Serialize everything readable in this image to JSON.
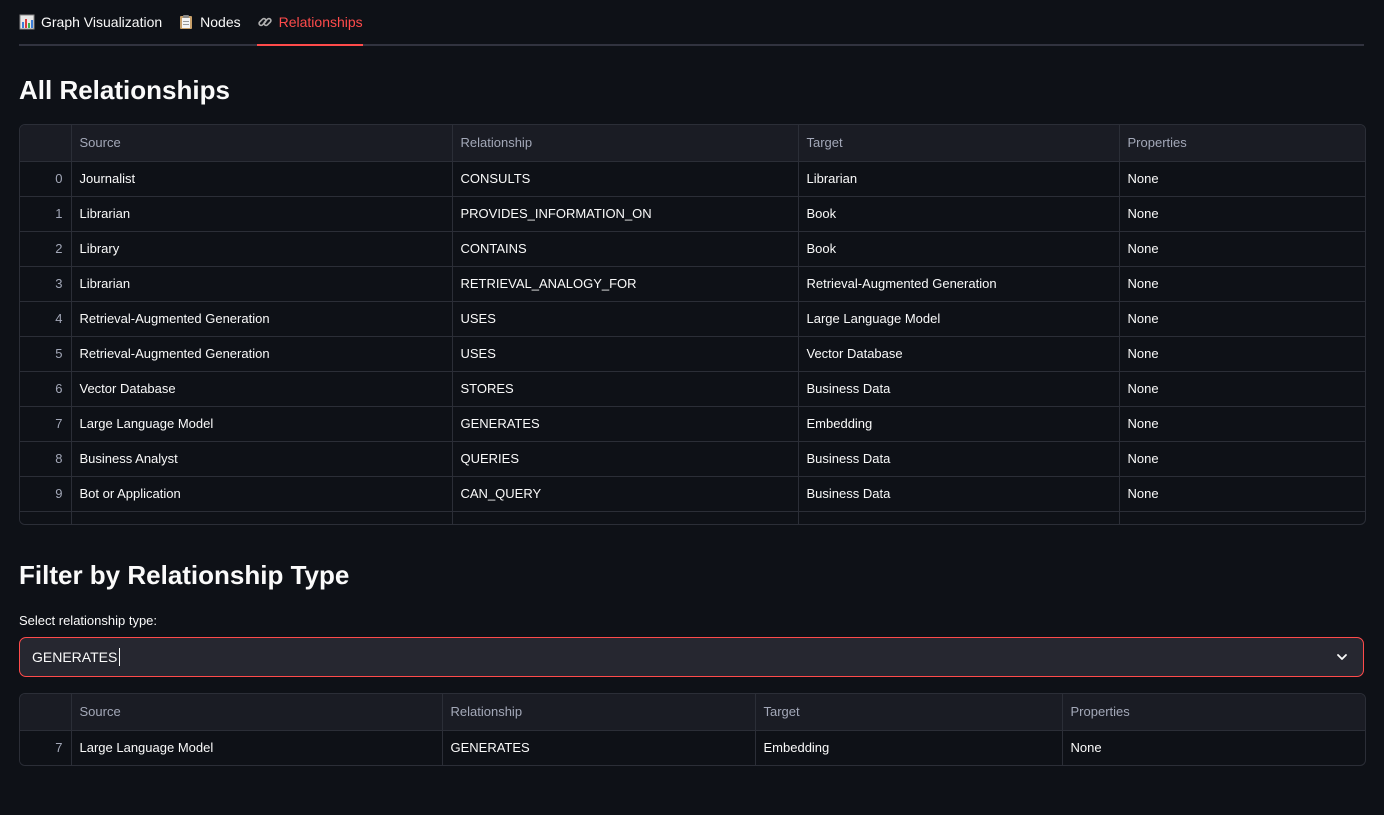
{
  "tabs": [
    {
      "label": "Graph Visualization",
      "icon": "bar-chart-icon",
      "active": false
    },
    {
      "label": "Nodes",
      "icon": "clipboard-icon",
      "active": false
    },
    {
      "label": "Relationships",
      "icon": "link-icon",
      "active": true
    }
  ],
  "all_section": {
    "title": "All Relationships",
    "columns": [
      "",
      "Source",
      "Relationship",
      "Target",
      "Properties"
    ],
    "rows": [
      {
        "idx": "0",
        "source": "Journalist",
        "relationship": "CONSULTS",
        "target": "Librarian",
        "properties": "None"
      },
      {
        "idx": "1",
        "source": "Librarian",
        "relationship": "PROVIDES_INFORMATION_ON",
        "target": "Book",
        "properties": "None"
      },
      {
        "idx": "2",
        "source": "Library",
        "relationship": "CONTAINS",
        "target": "Book",
        "properties": "None"
      },
      {
        "idx": "3",
        "source": "Librarian",
        "relationship": "RETRIEVAL_ANALOGY_FOR",
        "target": "Retrieval-Augmented Generation",
        "properties": "None"
      },
      {
        "idx": "4",
        "source": "Retrieval-Augmented Generation",
        "relationship": "USES",
        "target": "Large Language Model",
        "properties": "None"
      },
      {
        "idx": "5",
        "source": "Retrieval-Augmented Generation",
        "relationship": "USES",
        "target": "Vector Database",
        "properties": "None"
      },
      {
        "idx": "6",
        "source": "Vector Database",
        "relationship": "STORES",
        "target": "Business Data",
        "properties": "None"
      },
      {
        "idx": "7",
        "source": "Large Language Model",
        "relationship": "GENERATES",
        "target": "Embedding",
        "properties": "None"
      },
      {
        "idx": "8",
        "source": "Business Analyst",
        "relationship": "QUERIES",
        "target": "Business Data",
        "properties": "None"
      },
      {
        "idx": "9",
        "source": "Bot or Application",
        "relationship": "CAN_QUERY",
        "target": "Business Data",
        "properties": "None"
      }
    ]
  },
  "filter_section": {
    "title": "Filter by Relationship Type",
    "select_label": "Select relationship type:",
    "selected_value": "GENERATES",
    "columns": [
      "",
      "Source",
      "Relationship",
      "Target",
      "Properties"
    ],
    "rows": [
      {
        "idx": "7",
        "source": "Large Language Model",
        "relationship": "GENERATES",
        "target": "Embedding",
        "properties": "None"
      }
    ]
  },
  "colors": {
    "background": "#0e1117",
    "accent": "#ff4b4b",
    "header_bg": "#1a1c24",
    "border": "#2b2e37"
  }
}
